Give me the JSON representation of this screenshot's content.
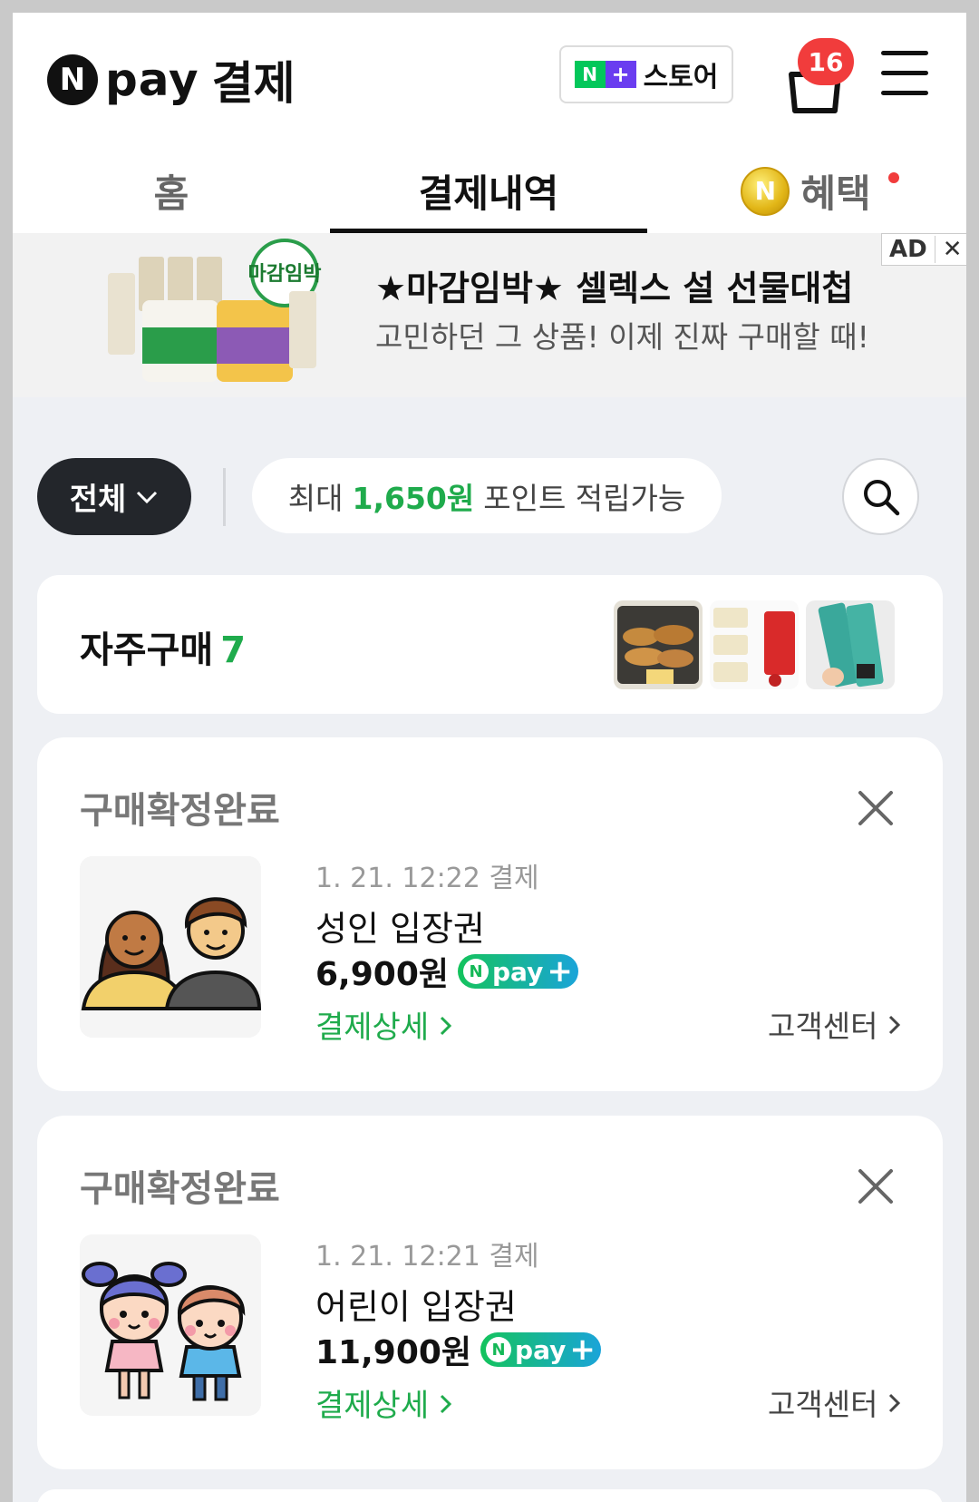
{
  "header": {
    "logo_n": "N",
    "logo_pay": "pay",
    "title": "결제",
    "store_button": {
      "n": "N",
      "plus": "+",
      "label": "스토어"
    },
    "cart_badge": "16"
  },
  "tabs": [
    {
      "label": "홈",
      "active": false
    },
    {
      "label": "결제내역",
      "active": true
    },
    {
      "label": "혜택",
      "active": false,
      "coin": "N"
    }
  ],
  "ad": {
    "title": "★마감임박★ 셀렉스 설 선물대첩",
    "subtitle": "고민하던 그 상품! 이제 진짜 구매할 때!",
    "tag_label": "AD",
    "tag_close": "✕",
    "image_text": "마감임박"
  },
  "filter": {
    "all_label": "전체",
    "points_prefix": "최대",
    "points_amount": "1,650원",
    "points_suffix": "포인트 적립가능"
  },
  "frequent": {
    "title": "자주구매",
    "count": "7"
  },
  "orders": [
    {
      "status": "구매확정완료",
      "date": "1. 21. 12:22 결제",
      "name": "성인 입장권",
      "price": "6,900원",
      "badge_n": "N",
      "badge_pay": "pay",
      "badge_plus": "+",
      "detail_label": "결제상세",
      "cs_label": "고객센터"
    },
    {
      "status": "구매확정완료",
      "date": "1. 21. 12:21 결제",
      "name": "어린이 입장권",
      "price": "11,900원",
      "badge_n": "N",
      "badge_pay": "pay",
      "badge_plus": "+",
      "detail_label": "결제상세",
      "cs_label": "고객센터"
    }
  ],
  "colors": {
    "accent_green": "#1fab4c",
    "badge_red": "#f13c3c",
    "filter_dark": "#23262b"
  }
}
